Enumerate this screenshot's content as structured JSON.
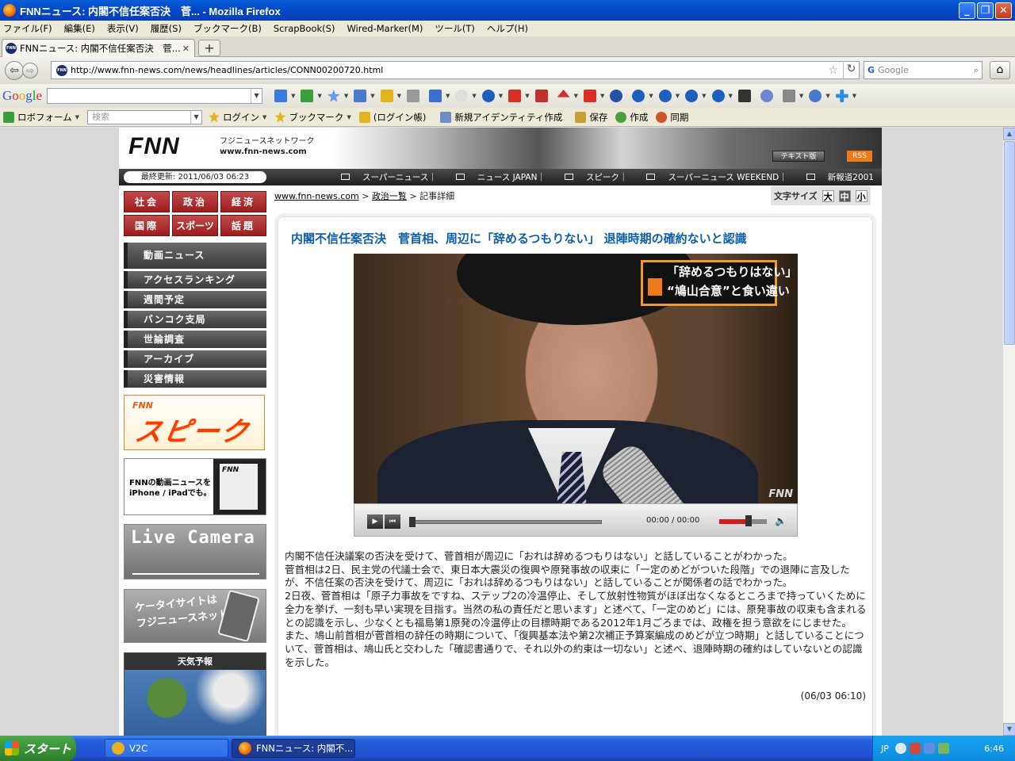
{
  "window": {
    "title": "FNNニュース: 内閣不信任案否決　菅... - Mozilla Firefox"
  },
  "menu": [
    "ファイル(F)",
    "編集(E)",
    "表示(V)",
    "履歴(S)",
    "ブックマーク(B)",
    "ScrapBook(S)",
    "Wired-Marker(M)",
    "ツール(T)",
    "ヘルプ(H)"
  ],
  "tab": {
    "label": "FNNニュース: 内閣不信任案否決　菅...",
    "new_tab": "+"
  },
  "nav": {
    "url": "http://www.fnn-news.com/news/headlines/articles/CONN00200720.html",
    "search_placeholder": "Google"
  },
  "google_toolbar": {
    "logo": [
      "G",
      "o",
      "o",
      "g",
      "l",
      "e"
    ]
  },
  "bookmarks": {
    "roboform": "ロボフォーム",
    "search_placeholder": "検索",
    "login": "ログイン",
    "bookmark": "ブックマーク",
    "login_book": "(ログイン帳)",
    "new_identity": "新規アイデンティティ作成",
    "save": "保存",
    "create": "作成",
    "sync": "同期"
  },
  "site": {
    "logo": "FNN",
    "logo_sub": "フジニュースネットワーク",
    "logo_url": "www.fnn-news.com",
    "text_version": "テキスト版",
    "rss": "RSS",
    "updated": "最終更新: 2011/06/03 06:23",
    "sublinks": [
      "スーパーニュース｜",
      "ニュース JAPAN｜",
      "スピーク｜",
      "スーパーニュース WEEKEND｜",
      "新報道2001"
    ],
    "categories": [
      "社会",
      "政治",
      "経済",
      "国際",
      "スポーツ",
      "話題"
    ],
    "side_menu": [
      "動画ニュース",
      "アクセスランキング",
      "週間予定",
      "バンコク支局",
      "世論調査",
      "アーカイブ",
      "災害情報"
    ],
    "speak_small": "FNN",
    "speak_big": "スピーク",
    "iphone_text": [
      "FNNの動画ニュースを",
      "iPhone / iPadでも。"
    ],
    "iphone_logo": "FNN",
    "live_camera": "Live Camera",
    "keitai": [
      "ケータイサイトは",
      "フジニュースネット"
    ],
    "weather": "天気予報"
  },
  "breadcrumb": {
    "home": "www.fnn-news.com",
    "sep1": " > ",
    "politics": "政治一覧",
    "sep2": " > ",
    "current": "記事詳細"
  },
  "font_size": {
    "label": "文字サイズ",
    "large": "大",
    "medium": "中",
    "small": "小"
  },
  "article": {
    "headline": "内閣不信任案否決　菅首相、周辺に「辞めるつもりない」 退陣時期の確約ないと認識",
    "caption": [
      "「辞めるつもりはない」",
      "“鳩山合意”と食い違い"
    ],
    "watermark": "FNN",
    "time": "00:00 / 00:00",
    "paragraphs": [
      "内閣不信任決議案の否決を受けて、菅首相が周辺に「おれは辞めるつもりはない」と話していることがわかった。",
      "菅首相は2日、民主党の代議士会で、東日本大震災の復興や原発事故の収束に「一定のめどがついた段階」での退陣に言及したが、不信任案の否決を受けて、周辺に「おれは辞めるつもりはない」と話していることが関係者の話でわかった。",
      "2日夜、菅首相は「原子力事故をですね、ステップ2の冷温停止、そして放射性物質がほぼ出なくなるところまで持っていくために全力を挙げ、一刻も早い実現を目指す。当然の私の責任だと思います」と述べて、「一定のめど」には、原発事故の収束も含まれるとの認識を示し、少なくとも福島第1原発の冷温停止の目標時期である2012年1月ごろまでは、政権を担う意欲をにじませた。",
      "また、鳩山前首相が菅首相の辞任の時期について、「復興基本法や第2次補正予算案編成のめどが立つ時期」と話していることについて、菅首相は、鳩山氏と交わした「確認書通りで、それ以外の約束は一切ない」と述べ、退陣時期の確約はしていないとの認識を示した。"
    ],
    "timestamp": "(06/03 06:10)"
  },
  "taskbar": {
    "start": "スタート",
    "items": [
      "V2C",
      "FNNニュース: 内閣不..."
    ],
    "tray_lang": "JP",
    "clock": "6:46"
  },
  "colors": {
    "headline": "#0e5ea8",
    "category": "#9b1d1d",
    "xp_blue": "#245ddb"
  }
}
